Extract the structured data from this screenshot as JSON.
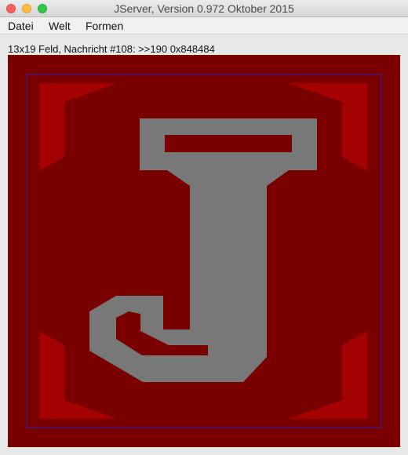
{
  "window": {
    "title": "JServer, Version 0.972 Oktober 2015"
  },
  "menu": {
    "items": [
      "Datei",
      "Welt",
      "Formen"
    ]
  },
  "status": {
    "text": "13x19 Feld, Nachricht #108: >>190 0x848484"
  },
  "canvas": {
    "colors": {
      "background": "#7a0000",
      "corner_accent": "#a50000",
      "letter": "#787878",
      "frame_line": "#3a1a8a"
    },
    "letter": "J"
  }
}
